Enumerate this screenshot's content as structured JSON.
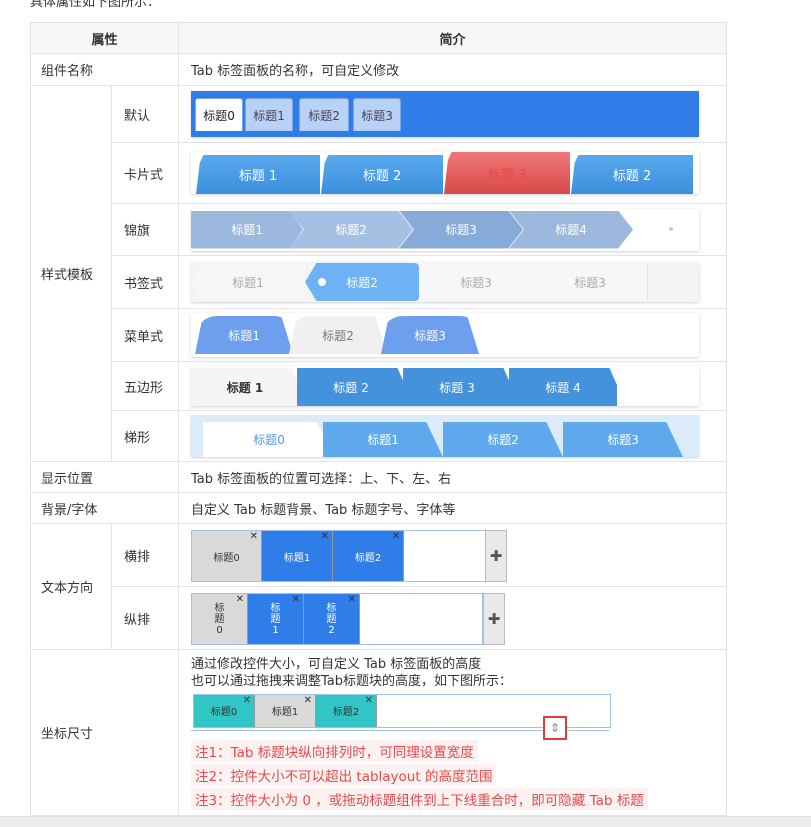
{
  "intro": "具体属性如下图所示：",
  "headers": {
    "col1": "属性",
    "col2": "简介"
  },
  "rows": {
    "name": {
      "label": "组件名称",
      "desc": "Tab 标签面板的名称，可自定义修改"
    },
    "style": {
      "label": "样式模板",
      "default": {
        "label": "默认",
        "tabs": [
          "标题0",
          "标题1",
          "标题2",
          "标题3"
        ]
      },
      "card": {
        "label": "卡片式",
        "tabs": [
          "标题 1",
          "标题 2",
          "标题 3",
          "标题 2"
        ]
      },
      "flag": {
        "label": "锦旗",
        "tabs": [
          "标题1",
          "标题2",
          "标题3",
          "标题4"
        ]
      },
      "bookmark": {
        "label": "书签式",
        "tabs": [
          "标题1",
          "标题2",
          "标题3",
          "标题3"
        ]
      },
      "menu": {
        "label": "菜单式",
        "tabs": [
          "标题1",
          "标题2",
          "标题3"
        ]
      },
      "pentagon": {
        "label": "五边形",
        "tabs": [
          "标题 1",
          "标题 2",
          "标题 3",
          "标题 4"
        ]
      },
      "trapezoid": {
        "label": "梯形",
        "tabs": [
          "标题0",
          "标题1",
          "标题2",
          "标题3"
        ]
      }
    },
    "position": {
      "label": "显示位置",
      "desc": "Tab 标签面板的位置可选择：上、下、左、右"
    },
    "bgfont": {
      "label": "背景/字体",
      "desc": "自定义 Tab 标题背景、Tab 标题字号、字体等"
    },
    "textdir": {
      "label": "文本方向",
      "horizontal": {
        "label": "横排",
        "tabs": [
          "标题0",
          "标题1",
          "标题2"
        ]
      },
      "vertical": {
        "label": "纵排",
        "tabs": [
          "标\n题\n0",
          "标\n题\n1",
          "标\n题\n2"
        ]
      },
      "close": "✕",
      "add": "✚"
    },
    "size": {
      "label": "坐标尺寸",
      "line1": "通过修改控件大小，可自定义 Tab 标签面板的高度",
      "line2": "也可以通过拖拽来调整Tab标题块的高度，如下图所示：",
      "tabs": [
        "标题0",
        "标题1",
        "标题2"
      ],
      "notes": [
        "注1：Tab 标题块纵向排列时，可同理设置宽度",
        "注2：控件大小不可以超出 tablayout 的高度范围",
        "注3：控件大小为 0 ，或拖动标题组件到上下线重合时，即可隐藏 Tab 标题"
      ]
    }
  },
  "colors": {
    "accent": "#2f7de8",
    "note": "#e64a4a"
  }
}
